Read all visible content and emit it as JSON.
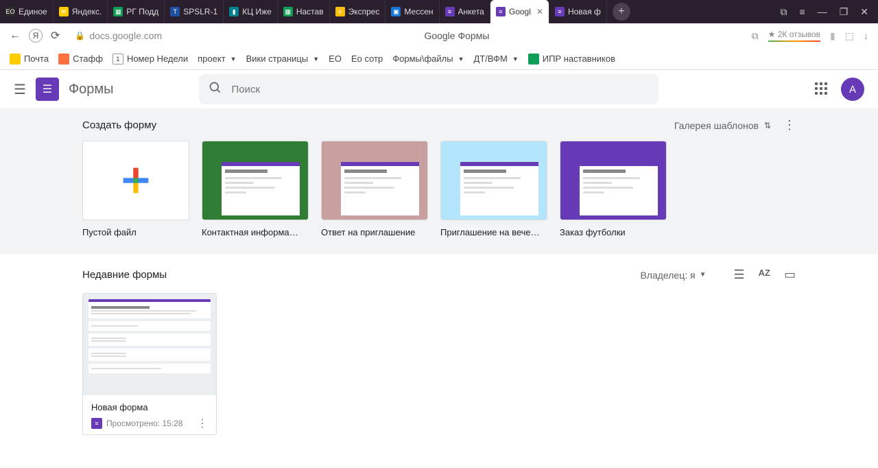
{
  "browser": {
    "tabs": [
      {
        "label": "Единое",
        "fav_bg": "#2a2a2a",
        "fav_txt": "ЕО"
      },
      {
        "label": "Яндекс.",
        "fav_bg": "#ffcc00",
        "fav_txt": "✉"
      },
      {
        "label": "РГ Подд",
        "fav_bg": "#0f9d58",
        "fav_txt": "▦"
      },
      {
        "label": "SPSLR-1",
        "fav_bg": "#1e50a2",
        "fav_txt": "T"
      },
      {
        "label": "КЦ Иже",
        "fav_bg": "#00838f",
        "fav_txt": "▮"
      },
      {
        "label": "Настав",
        "fav_bg": "#0f9d58",
        "fav_txt": "▦"
      },
      {
        "label": "Экспрес",
        "fav_bg": "#ffc107",
        "fav_txt": "≡"
      },
      {
        "label": "Мессен",
        "fav_bg": "#1976d2",
        "fav_txt": "▣"
      },
      {
        "label": "Анкета",
        "fav_bg": "#673ab7",
        "fav_txt": "≡"
      },
      {
        "label": "Googl",
        "fav_bg": "#673ab7",
        "fav_txt": "≡"
      },
      {
        "label": "Новая ф",
        "fav_bg": "#673ab7",
        "fav_txt": "≡"
      }
    ],
    "active_tab_index": 9
  },
  "address": {
    "url": "docs.google.com",
    "page_title": "Google Формы",
    "reviews": "★ 2К отзывов"
  },
  "bookmarks": [
    {
      "label": "Почта",
      "ic_bg": "#ffcc00"
    },
    {
      "label": "Стафф",
      "ic_bg": "#ff7043"
    },
    {
      "label": "Номер Недели",
      "ic_bg": "#fff",
      "ic_txt": "1",
      "border": "1px solid #999"
    },
    {
      "label": "проект",
      "caret": true
    },
    {
      "label": "Вики страницы",
      "caret": true
    },
    {
      "label": "ЕО"
    },
    {
      "label": "Ео сотр"
    },
    {
      "label": "Формы\\файлы",
      "caret": true
    },
    {
      "label": "ДТ/ВФМ",
      "caret": true
    },
    {
      "label": "ИПР наставников",
      "ic_bg": "#0f9d58"
    }
  ],
  "app": {
    "title": "Формы",
    "search_placeholder": "Поиск",
    "avatar_letter": "А"
  },
  "templates": {
    "heading": "Создать форму",
    "gallery_label": "Галерея шаблонов",
    "cards": [
      {
        "name": "Пустой файл",
        "kind": "blank"
      },
      {
        "name": "Контактная информа…",
        "kind": "contact",
        "bg": "#2e7d32"
      },
      {
        "name": "Ответ на приглашение",
        "kind": "rsvp",
        "bg": "#c8a0a0"
      },
      {
        "name": "Приглашение на вече…",
        "kind": "party",
        "bg": "#b3e5fc"
      },
      {
        "name": "Заказ футболки",
        "kind": "tshirt",
        "bg": "#673ab7"
      }
    ]
  },
  "recent": {
    "heading": "Недавние формы",
    "owner_label": "Владелец: я",
    "items": [
      {
        "title": "Новая форма",
        "subtitle": "Просмотрено: 15:28"
      }
    ]
  }
}
